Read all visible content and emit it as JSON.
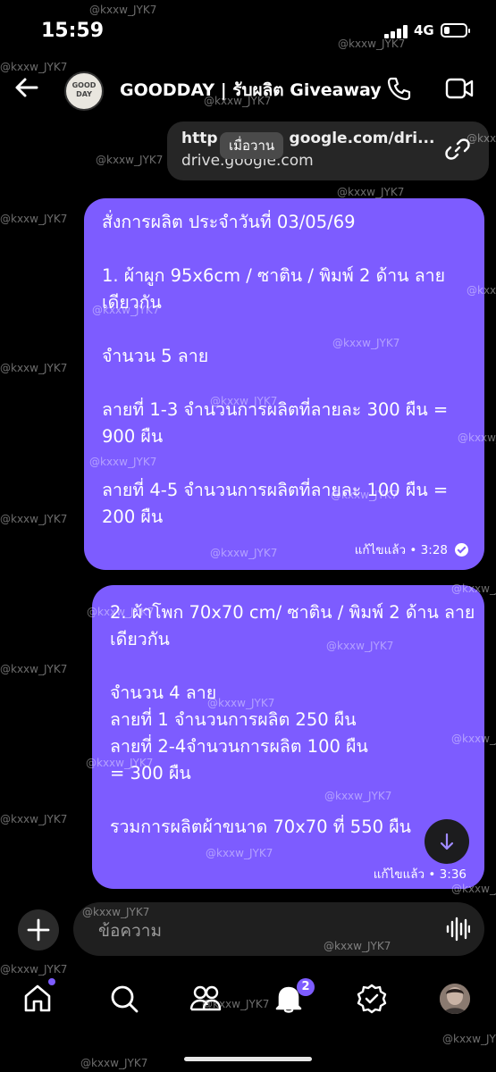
{
  "status_bar": {
    "time": "15:59",
    "network": "4G"
  },
  "header": {
    "title": "GOODDAY | รับผลิต Giveaway",
    "avatar_text": "GOOD DAY"
  },
  "link_preview": {
    "url_left": "http",
    "url_right": "google.com/dri...",
    "domain": "drive.google.com",
    "tooltip": "เมื่อวาน"
  },
  "messages": [
    {
      "text": "สั่งการผลิต ประจำวันที่ 03/05/69\n\n1. ผ้าผูก 95x6cm / ซาติน / พิมพ์ 2 ด้าน ลายเดียวกัน\n\nจำนวน 5 ลาย\n\nลายที่ 1-3 จำนวนการผลิตที่ลายละ 300 ผืน = 900 ผืน\n\nลายที่ 4-5 จำนวนการผลิตที่ลายละ 100 ผืน = 200 ผืน",
      "meta": "แก้ไขแล้ว • 3:28"
    },
    {
      "text": "2. ผ้าโพก 70x70 cm/ ซาติน / พิมพ์ 2 ด้าน ลายเดียวกัน\n\nจำนวน 4 ลาย\nลายที่ 1 จำนวนการผลิต 250 ผืน\nลายที่ 2-4จำนวนการผลิต 100 ผืน\n= 300 ผืน\n\nรวมการผลิตผ้าขนาด 70x70 ที่ 550 ผืน",
      "meta": "แก้ไขแล้ว • 3:36"
    }
  ],
  "composer": {
    "placeholder": "ข้อความ"
  },
  "nav": {
    "notification_count": "2"
  },
  "watermark": "@kxxw_JYK7",
  "colors": {
    "accent": "#7d5cff",
    "background": "#000000"
  },
  "icons": [
    "back-arrow-icon",
    "phone-icon",
    "video-icon",
    "link-icon",
    "check-icon",
    "arrow-down-icon",
    "plus-icon",
    "waveform-icon",
    "home-icon",
    "search-icon",
    "people-icon",
    "bell-icon",
    "badge-check-icon"
  ]
}
